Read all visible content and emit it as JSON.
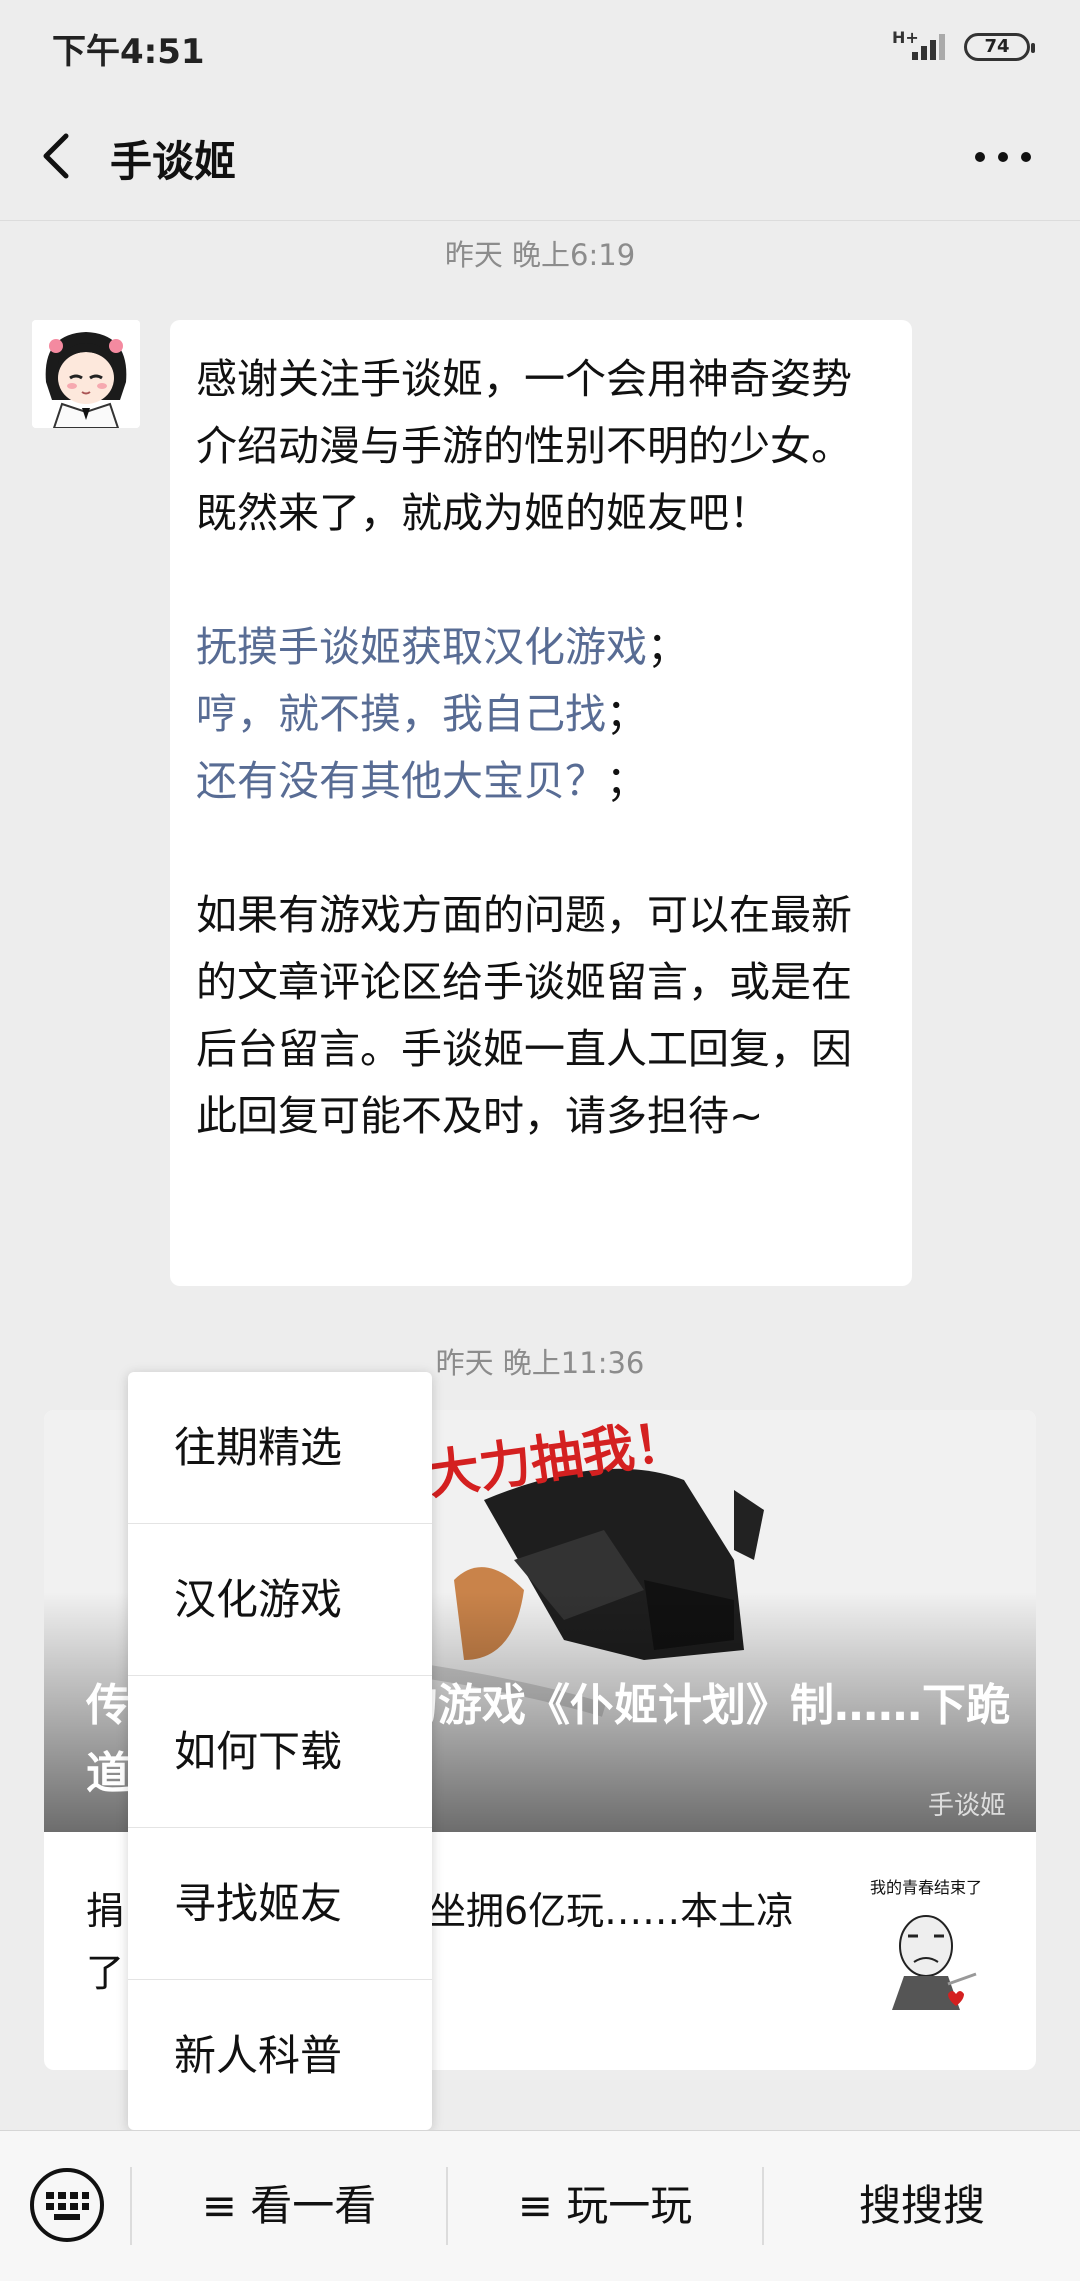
{
  "status_bar": {
    "time": "下午4:51",
    "network": "H+",
    "battery": "74"
  },
  "header": {
    "title": "手谈姬"
  },
  "messages": [
    {
      "timestamp": "昨天 晚上6:19",
      "paragraph1": "感谢关注手谈姬，一个会用神奇姿势介绍动漫与手游的性别不明的少女。既然来了，就成为姬的姬友吧！",
      "links": [
        {
          "text": "抚摸手谈姬获取汉化游戏",
          "suffix": "；"
        },
        {
          "text": "哼，就不摸，我自己找",
          "suffix": "；"
        },
        {
          "text": "还有没有其他大宝贝？",
          "suffix": "；"
        }
      ],
      "paragraph2": "如果有游戏方面的问题，可以在最新的文章评论区给手谈姬留言，或是在后台留言。手谈姬一直人工回复，因此回复可能不及时，请多担待~"
    },
    {
      "timestamp": "昨天 晚上11:36",
      "article": {
        "cover_caption": "大力抽我！",
        "title": "传……女装大佬的游戏《仆姬计划》制……下跪道歉……",
        "watermark": "手谈姬",
        "sub_title": "捐……索尼拍电影、坐拥6亿玩……本土凉了……",
        "sub_thumb_caption": "我的青春结束了"
      }
    }
  ],
  "popup_menu": {
    "items": [
      "往期精选",
      "汉化游戏",
      "如何下载",
      "寻找姬友",
      "新人科普"
    ]
  },
  "bottom_bar": {
    "menus": [
      "≡ 看一看",
      "≡ 玩一玩",
      "搜搜搜"
    ]
  }
}
